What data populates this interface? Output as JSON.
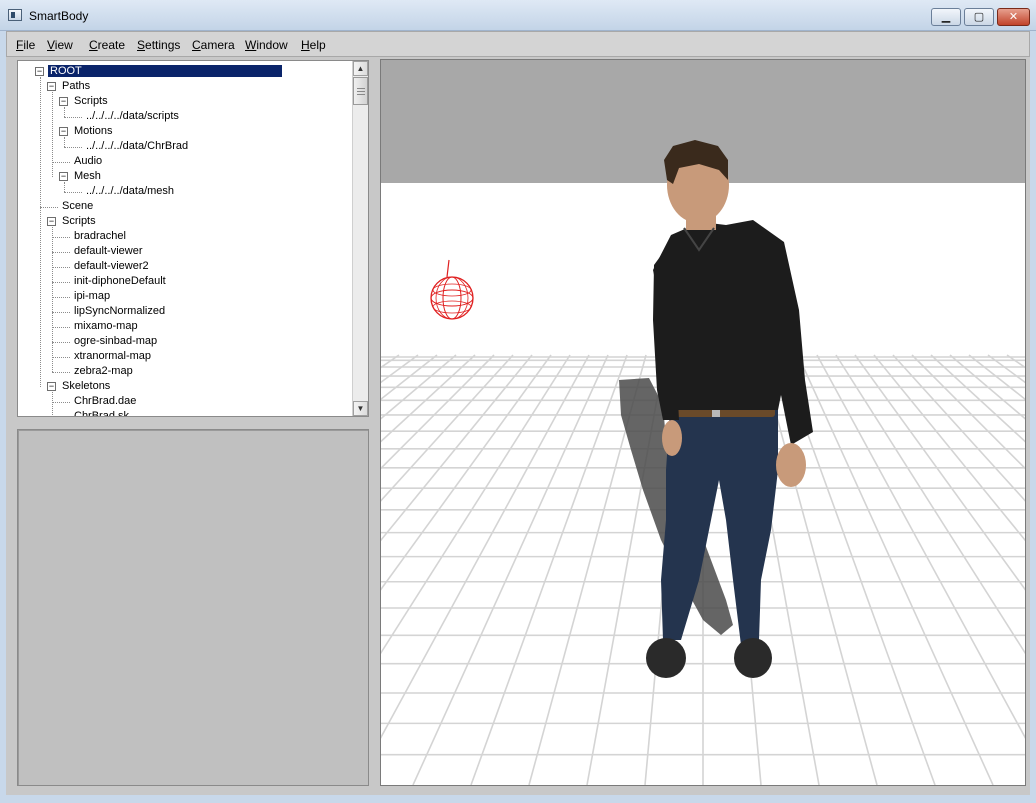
{
  "window": {
    "title": "SmartBody",
    "minimize_glyph": "▁",
    "maximize_glyph": "▢",
    "close_glyph": "✕"
  },
  "menu": [
    {
      "name": "menu-file",
      "label": "File",
      "mnemonic": "F",
      "rest": "ile"
    },
    {
      "name": "menu-view",
      "label": "View",
      "mnemonic": "V",
      "rest": "iew"
    },
    {
      "name": "menu-create",
      "label": "Create",
      "mnemonic": "C",
      "rest": "reate"
    },
    {
      "name": "menu-settings",
      "label": "Settings",
      "mnemonic": "S",
      "rest": "ettings"
    },
    {
      "name": "menu-camera",
      "label": "Camera",
      "mnemonic": "C",
      "rest": "amera"
    },
    {
      "name": "menu-window",
      "label": "Window",
      "mnemonic": "W",
      "rest": "indow"
    },
    {
      "name": "menu-help",
      "label": "Help",
      "mnemonic": "H",
      "rest": "elp"
    }
  ],
  "tree": {
    "nodes": [
      {
        "label": "ROOT",
        "depth": 0,
        "toggle": "−",
        "selected": true
      },
      {
        "label": "Paths",
        "depth": 1,
        "toggle": "−"
      },
      {
        "label": "Scripts",
        "depth": 2,
        "toggle": "−"
      },
      {
        "label": "../../../../data/scripts",
        "depth": 3
      },
      {
        "label": "Motions",
        "depth": 2,
        "toggle": "−"
      },
      {
        "label": "../../../../data/ChrBrad",
        "depth": 3
      },
      {
        "label": "Audio",
        "depth": 2
      },
      {
        "label": "Mesh",
        "depth": 2,
        "toggle": "−"
      },
      {
        "label": "../../../../data/mesh",
        "depth": 3
      },
      {
        "label": "Scene",
        "depth": 1
      },
      {
        "label": "Scripts",
        "depth": 1,
        "toggle": "−"
      },
      {
        "label": "bradrachel",
        "depth": 2
      },
      {
        "label": "default-viewer",
        "depth": 2
      },
      {
        "label": "default-viewer2",
        "depth": 2
      },
      {
        "label": "init-diphoneDefault",
        "depth": 2
      },
      {
        "label": "ipi-map",
        "depth": 2
      },
      {
        "label": "lipSyncNormalized",
        "depth": 2
      },
      {
        "label": "mixamo-map",
        "depth": 2
      },
      {
        "label": "ogre-sinbad-map",
        "depth": 2
      },
      {
        "label": "xtranormal-map",
        "depth": 2
      },
      {
        "label": "zebra2-map",
        "depth": 2
      },
      {
        "label": "Skeletons",
        "depth": 1,
        "toggle": "−"
      },
      {
        "label": "ChrBrad.dae",
        "depth": 2
      },
      {
        "label": "ChrBrad.sk",
        "depth": 2
      }
    ],
    "scroll_up_glyph": "▲",
    "scroll_down_glyph": "▼"
  },
  "viewport": {
    "colors": {
      "sky": "#a8a8a8",
      "floor": "#ffffff",
      "grid": "#d4d4d4",
      "light_marker": "#e02020",
      "shirt": "#1c1c1c",
      "jeans": "#24344e",
      "skin": "#c89a7a",
      "hair": "#3a2a1c",
      "belt": "#6a4a2a",
      "shadow": "#4a4a4a"
    },
    "icons": [
      "light-sphere-icon"
    ]
  }
}
